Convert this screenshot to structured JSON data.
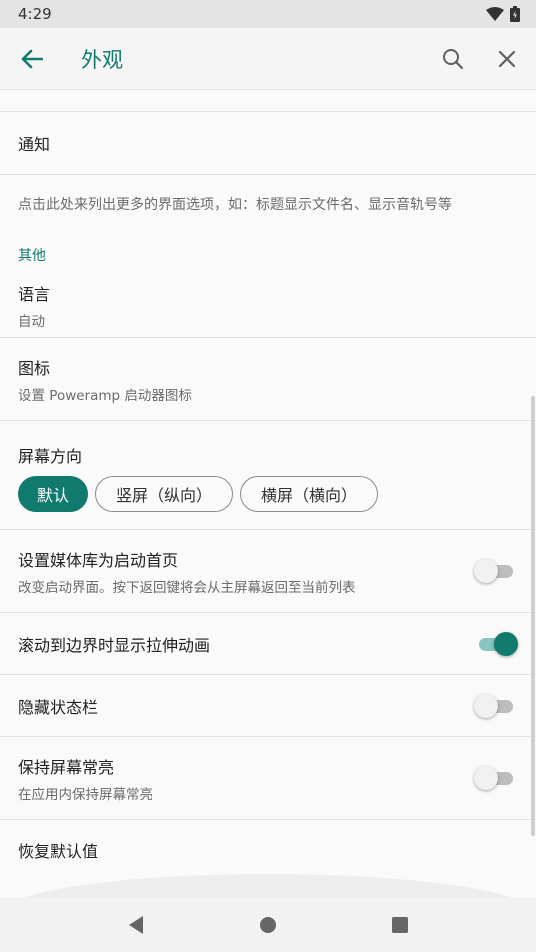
{
  "status_bar": {
    "time": "4:29"
  },
  "app_bar": {
    "title": "外观"
  },
  "notification": {
    "title": "通知"
  },
  "info_text": "点击此处来列出更多的界面选项，如：标题显示文件名、显示音轨号等",
  "category_other": "其他",
  "language": {
    "title": "语言",
    "subtitle": "自动"
  },
  "icon_pref": {
    "title": "图标",
    "subtitle": "设置 Poweramp 启动器图标"
  },
  "orientation": {
    "title": "屏幕方向",
    "options": [
      "默认",
      "竖屏（纵向）",
      "横屏（横向）"
    ],
    "selected": "默认"
  },
  "library_start": {
    "title": "设置媒体库为启动首页",
    "subtitle": "改变启动界面。按下返回键将会从主屏幕返回至当前列表",
    "enabled": false
  },
  "stretch_anim": {
    "title": "滚动到边界时显示拉伸动画",
    "enabled": true
  },
  "hide_status": {
    "title": "隐藏状态栏",
    "enabled": false
  },
  "keep_screen": {
    "title": "保持屏幕常亮",
    "subtitle": "在应用内保持屏幕常亮",
    "enabled": false
  },
  "restore": {
    "title": "恢复默认值"
  },
  "colors": {
    "accent": "#117a6e",
    "accent_light": "#86c6bf"
  }
}
